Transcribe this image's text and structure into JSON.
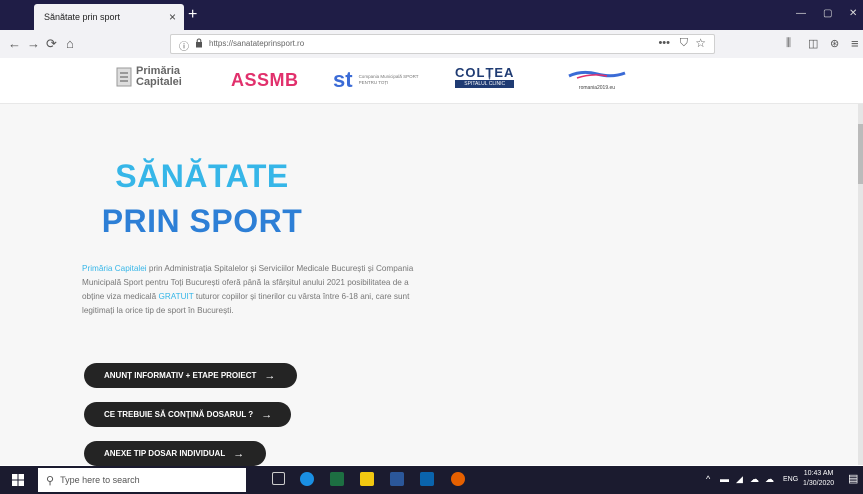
{
  "browser": {
    "tab_title": "Sănătate prin sport",
    "tab_close": "×",
    "new_tab": "+",
    "url": "https://sanatateprinsport.ro",
    "nav_icons": [
      "back-arrow-icon",
      "forward-arrow-icon",
      "refresh-icon",
      "home-icon"
    ],
    "more_label": "•••"
  },
  "logos": {
    "primaria": "Primăria Capitalei",
    "assmb": "ASSMB",
    "st": "st",
    "st_sub": "Compania Municipală SPORT PENTRU TOȚI",
    "coltea": "COLȚEA",
    "coltea_sub": "SPITALUL CLINIC",
    "romania_label": "romania2019.eu"
  },
  "hero": {
    "title_line1": "SĂNĂTATE",
    "title_line2": "PRIN SPORT",
    "highlight1": "Primăria Capitalei",
    "desc_part1": " prin Administrația Spitalelor și Serviciilor Medicale București și Compania Municipală Sport pentru Toți București oferă până la sfârșitul anului 2021 posibilitatea de a obține viza medicală ",
    "highlight2": "GRATUIT",
    "desc_part2": " tuturor copiilor și tinerilor cu vârsta între 6-18 ani, care sunt legitimați la orice tip de sport în București."
  },
  "buttons": {
    "b1": "ANUNȚ INFORMATIV + ETAPE PROIECT",
    "b2": "CE TREBUIE SĂ CONȚINĂ DOSARUL ?",
    "b3": "ANEXE TIP DOSAR INDIVIDUAL",
    "arrow": "→"
  },
  "taskbar": {
    "search_placeholder": "Type here to search",
    "lang": "ENG",
    "time": "10:43 AM",
    "date": "1/30/2020"
  },
  "colors": {
    "accent_light": "#36b6e8",
    "accent_dark": "#2d7fd6",
    "button_bg": "#242424"
  }
}
